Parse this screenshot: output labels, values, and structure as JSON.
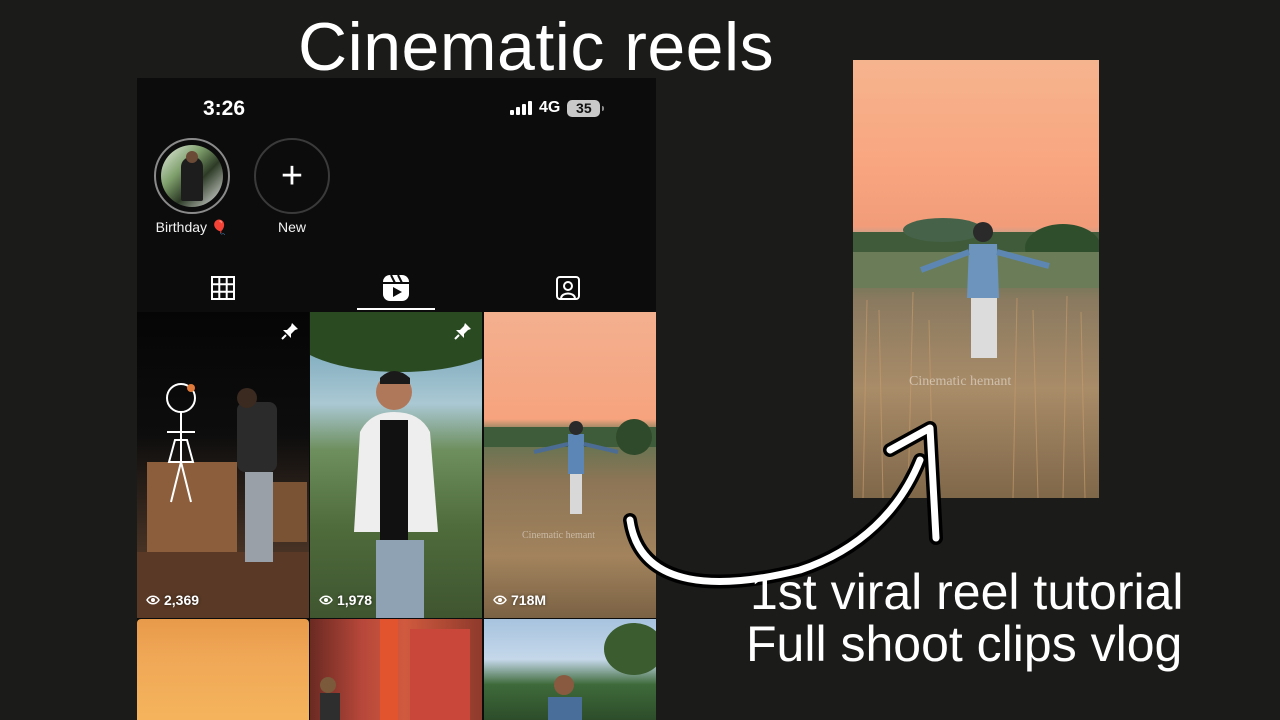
{
  "title": "Cinematic reels",
  "status": {
    "time": "3:26",
    "network": "4G",
    "battery": "35"
  },
  "highlights": [
    {
      "label": "Birthday 🎈"
    },
    {
      "label": "New"
    }
  ],
  "tabs": [
    "grid-icon",
    "reels-icon",
    "tagged-icon"
  ],
  "active_tab": 1,
  "reels": [
    {
      "views": "2,369",
      "pinned": true
    },
    {
      "views": "1,978",
      "pinned": true
    },
    {
      "views": "718M",
      "pinned": false
    }
  ],
  "watermark": "Cinematic hemant",
  "captions": {
    "line1": "1st viral reel tutorial",
    "line2": "Full shoot clips vlog"
  },
  "colors": {
    "background": "#1b1b1a",
    "phone_bg": "#0c0c0d",
    "sunset": "#f6b48e"
  }
}
